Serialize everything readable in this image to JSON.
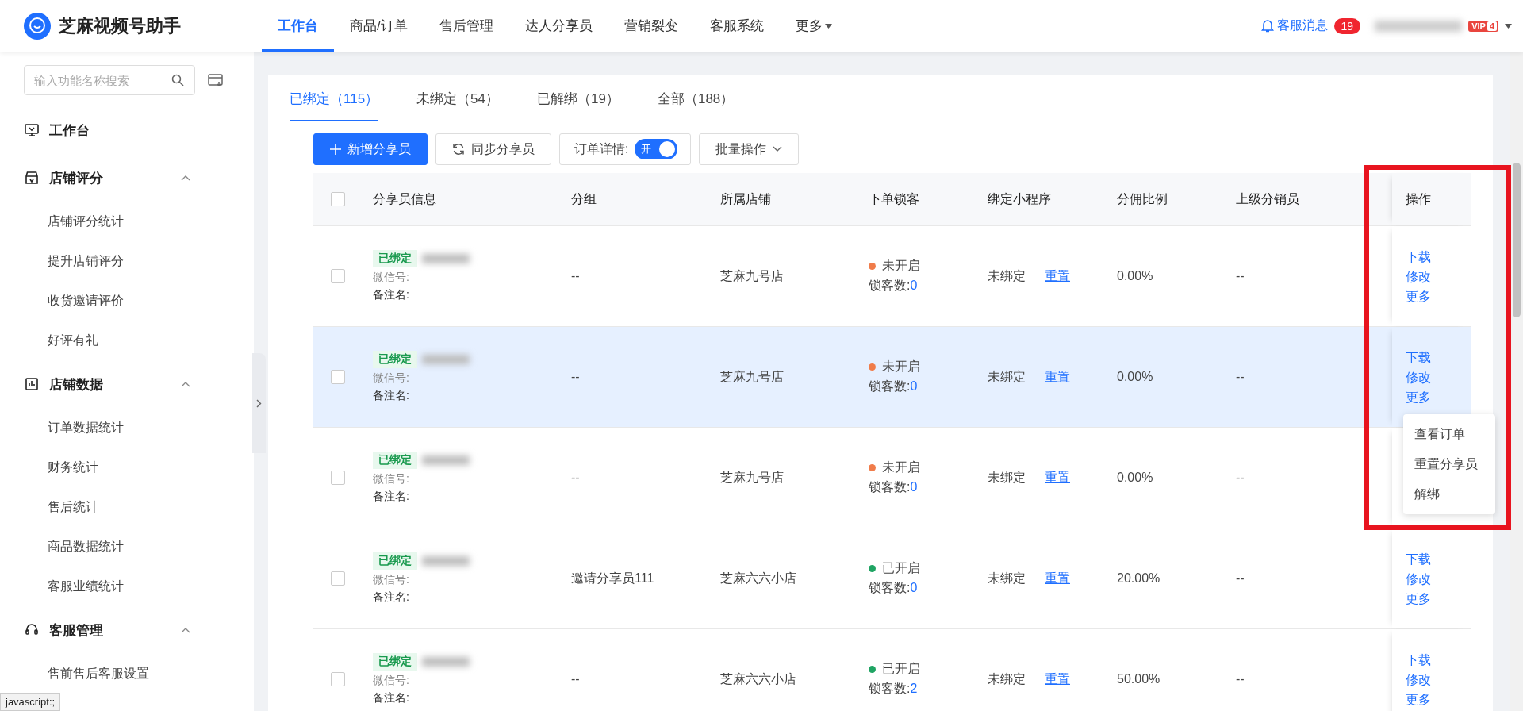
{
  "header": {
    "app_name": "芝麻视频号助手",
    "nav": [
      {
        "label": "工作台",
        "selected": true,
        "has_caret": false
      },
      {
        "label": "商品/订单",
        "selected": false,
        "has_caret": false
      },
      {
        "label": "售后管理",
        "selected": false,
        "has_caret": false
      },
      {
        "label": "达人分享员",
        "selected": false,
        "has_caret": false
      },
      {
        "label": "营销裂变",
        "selected": false,
        "has_caret": false
      },
      {
        "label": "客服系统",
        "selected": false,
        "has_caret": false
      },
      {
        "label": "更多",
        "selected": false,
        "has_caret": true
      }
    ],
    "messages": {
      "label": "客服消息",
      "count": "19"
    },
    "vip": {
      "text": "VIP",
      "level": "4"
    }
  },
  "sidebar": {
    "search": {
      "placeholder": "输入功能名称搜索"
    },
    "sections": [
      {
        "title": "工作台",
        "kind": "monitor"
      },
      {
        "title": "店铺评分",
        "kind": "shop",
        "expanded": true,
        "children": [
          {
            "label": "店铺评分统计"
          },
          {
            "label": "提升店铺评分"
          },
          {
            "label": "收货邀请评价"
          },
          {
            "label": "好评有礼"
          }
        ]
      },
      {
        "title": "店铺数据",
        "kind": "chart",
        "expanded": true,
        "children": [
          {
            "label": "订单数据统计"
          },
          {
            "label": "财务统计"
          },
          {
            "label": "售后统计"
          },
          {
            "label": "商品数据统计"
          },
          {
            "label": "客服业绩统计"
          }
        ]
      },
      {
        "title": "客服管理",
        "kind": "headset",
        "expanded": true,
        "children": [
          {
            "label": "售前售后客服设置"
          }
        ]
      }
    ]
  },
  "tabs": [
    {
      "label": "已绑定（115）",
      "selected": true
    },
    {
      "label": "未绑定（54）",
      "selected": false
    },
    {
      "label": "已解绑（19）",
      "selected": false
    },
    {
      "label": "全部（188）",
      "selected": false
    }
  ],
  "toolbar": {
    "add": "新增分享员",
    "sync": "同步分享员",
    "order_detail": {
      "label": "订单详情:",
      "switch_text": "开",
      "on": true
    },
    "batch": "批量操作"
  },
  "table": {
    "header_checked": false,
    "columns": [
      "分享员信息",
      "分组",
      "所属店铺",
      "下单锁客",
      "绑定小程序",
      "分佣比例",
      "上级分销员",
      "操作"
    ],
    "rows": [
      {
        "checked": false,
        "highlighted": false,
        "status": "已绑定",
        "wechat_label": "微信号:",
        "remark_label": "备注名:",
        "group": "--",
        "store": "芝麻九号店",
        "color": "#f07c4a",
        "lock_state": "未开启",
        "lock_label": "锁客数:",
        "lock_count": "0",
        "mini": "未绑定",
        "reset": "重置",
        "ratio": "0.00%",
        "parent": "--",
        "actions": [
          "下载",
          "修改",
          "更多"
        ]
      },
      {
        "checked": false,
        "highlighted": true,
        "status": "已绑定",
        "wechat_label": "微信号:",
        "remark_label": "备注名:",
        "group": "--",
        "store": "芝麻九号店",
        "color": "#f07c4a",
        "lock_state": "未开启",
        "lock_label": "锁客数:",
        "lock_count": "0",
        "mini": "未绑定",
        "reset": "重置",
        "ratio": "0.00%",
        "parent": "--",
        "actions": [
          "下载",
          "修改",
          "更多"
        ],
        "menu": [
          "查看订单",
          "重置分享员",
          "解绑"
        ]
      },
      {
        "checked": false,
        "highlighted": false,
        "status": "已绑定",
        "wechat_label": "微信号:",
        "remark_label": "备注名:",
        "group": "--",
        "store": "芝麻九号店",
        "color": "#f07c4a",
        "lock_state": "未开启",
        "lock_label": "锁客数:",
        "lock_count": "0",
        "mini": "未绑定",
        "reset": "重置",
        "ratio": "0.00%",
        "parent": "--"
      },
      {
        "checked": false,
        "highlighted": false,
        "status": "已绑定",
        "wechat_label": "微信号:",
        "remark_label": "备注名:",
        "group": "邀请分享员111",
        "store": "芝麻六六小店",
        "color": "#1fa463",
        "lock_state": "已开启",
        "lock_label": "锁客数:",
        "lock_count": "0",
        "mini": "未绑定",
        "reset": "重置",
        "ratio": "20.00%",
        "parent": "--",
        "actions": [
          "下载",
          "修改",
          "更多"
        ]
      },
      {
        "checked": false,
        "highlighted": false,
        "status": "已绑定",
        "wechat_label": "微信号:",
        "remark_label": "备注名:",
        "group": "--",
        "store": "芝麻六六小店",
        "color": "#1fa463",
        "lock_state": "已开启",
        "lock_label": "锁客数:",
        "lock_count": "2",
        "mini": "未绑定",
        "reset": "重置",
        "ratio": "50.00%",
        "parent": "--",
        "actions": [
          "下载",
          "修改",
          "更多"
        ]
      }
    ]
  },
  "status_bar": "javascript:;"
}
